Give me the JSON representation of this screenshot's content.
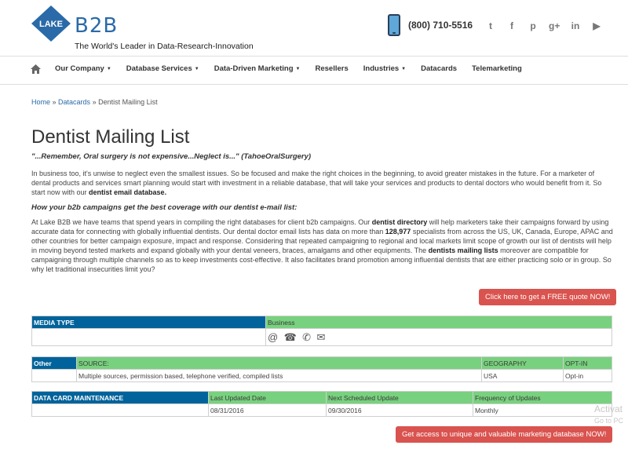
{
  "header": {
    "logo_text": "LAKE",
    "logo_b2b": "B2B",
    "tagline": "The World's Leader in Data-Research-Innovation",
    "phone": "(800) 710-5516",
    "social_icons": [
      "twitter-icon",
      "facebook-icon",
      "pinterest-icon",
      "google-plus-icon",
      "linkedin-icon",
      "youtube-icon"
    ]
  },
  "nav": {
    "items": [
      {
        "label": "Our Company",
        "dropdown": true
      },
      {
        "label": "Database Services",
        "dropdown": true
      },
      {
        "label": "Data-Driven Marketing",
        "dropdown": true
      },
      {
        "label": "Resellers",
        "dropdown": false
      },
      {
        "label": "Industries",
        "dropdown": true
      },
      {
        "label": "Datacards",
        "dropdown": false
      },
      {
        "label": "Telemarketing",
        "dropdown": false
      }
    ]
  },
  "breadcrumb": {
    "home": "Home",
    "sep": " » ",
    "datacards": "Datacards",
    "current": "Dentist Mailing List"
  },
  "content": {
    "title": "Dentist Mailing List",
    "quote": "\"...Remember, Oral surgery is not expensive...Neglect is...\" (TahoeOralSurgery)",
    "p1_a": "In business too, it's unwise to neglect even the smallest issues. So be focused and make the right choices in the beginning, to avoid greater mistakes in the future. For a marketer of dental products and services smart planning would start with investment in a reliable database, that will take your services and products to dental doctors who would benefit from it. So start now with our ",
    "p1_b": "dentist email database.",
    "subhead": "How your b2b campaigns get the best coverage with our dentist e-mail list:",
    "p2_a": "At Lake B2B we have teams that spend years in compiling the right databases for client b2b campaigns. Our ",
    "p2_b": "dentist directory",
    "p2_c": " will help marketers take their campaigns forward by using accurate data for connecting with globally influential dentists. Our dental doctor email lists has data on more than ",
    "p2_d": "128,977",
    "p2_e": " specialists from across the US, UK, Canada, Europe, APAC and other countries for better campaign exposure, impact and response. Considering that repeated campaigning to regional and local markets limit scope of growth our list of dentists will help in moving beyond tested markets and expand globally with your dental veneers, braces, amalgams and other equipments. The ",
    "p2_f": "dentists mailing lists",
    "p2_g": " moreover are compatible for campaigning through multiple channels so as to keep investments cost-effective. It also facilitates brand promotion among influential dentists that are either practicing solo or in group. So why let traditional insecurities limit you?"
  },
  "cta_top": "Click here to get a FREE quote NOW!",
  "cta_bottom": "Get access to unique and valuable marketing database NOW!",
  "media_table": {
    "header": "MEDIA TYPE",
    "value": "Business",
    "icons": [
      "at-icon",
      "fax-icon",
      "phone-icon",
      "envelope-icon"
    ]
  },
  "other_table": {
    "header": "Other",
    "source_label": "SOURCE:",
    "geo_label": "GEOGRAPHY",
    "optin_label": "OPT-IN",
    "source_value": "Multiple sources, permission based, telephone verified, compiled lists",
    "geo_value": "USA",
    "optin_value": "Opt-in"
  },
  "maintenance_table": {
    "header": "DATA CARD MAINTENANCE",
    "col1": "Last Updated Date",
    "col2": "Next Scheduled Update",
    "col3": "Frequency of Updates",
    "val1": "08/31/2016",
    "val2": "09/30/2016",
    "val3": "Monthly"
  },
  "watermark": {
    "line1": "Activat",
    "line2": "Go to PC"
  },
  "colors": {
    "brand_blue": "#00639b",
    "green": "#78d17e",
    "cta_red": "#d9534f"
  }
}
